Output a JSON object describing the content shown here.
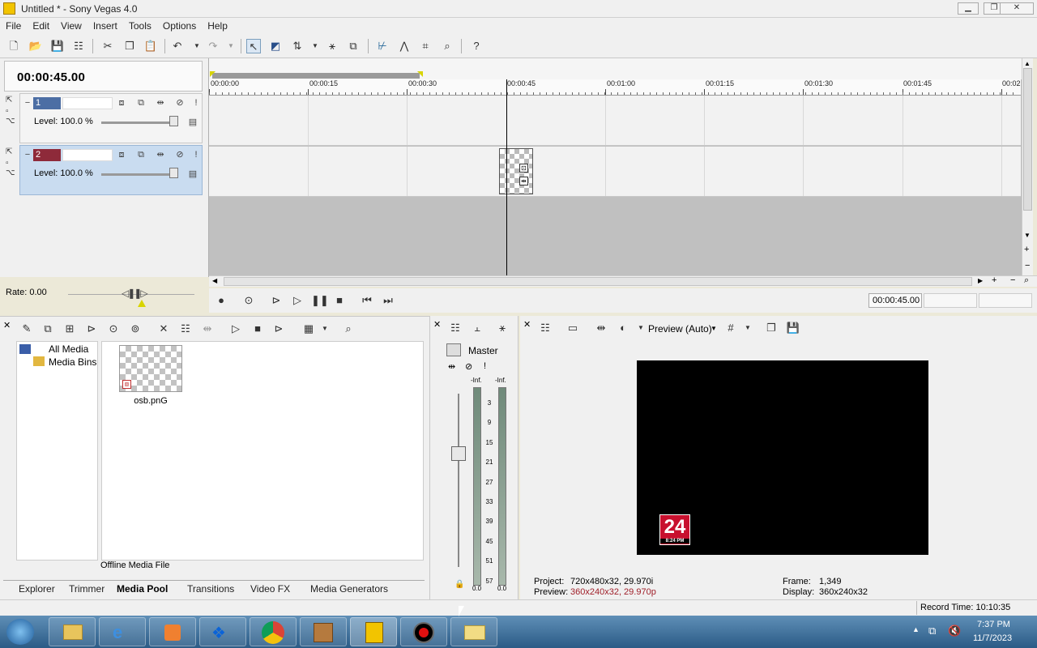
{
  "window": {
    "title": "Untitled * - Sony Vegas 4.0",
    "buttons": [
      "▁",
      "❐",
      "✕"
    ]
  },
  "menu": [
    "File",
    "Edit",
    "View",
    "Insert",
    "Tools",
    "Options",
    "Help"
  ],
  "toolbar": {
    "icons": [
      "new-icon",
      "open-icon",
      "save-icon",
      "properties-icon",
      "cut-icon",
      "copy-icon",
      "paste-icon",
      "undo-icon",
      "redo-icon",
      "normal-edit-tool-icon",
      "envelope-tool-icon",
      "selection-tool-icon",
      "ripple-icon",
      "auto-crossfade-icon",
      "snapping-icon",
      "markers-icon",
      "region-icon",
      "zoom-tool-icon",
      "whats-this-icon"
    ]
  },
  "timeline": {
    "cursor_time": "00:00:45.00",
    "ruler_ticks": [
      "00:00:00",
      "00:00:15",
      "00:00:30",
      "00:00:45",
      "00:01:00",
      "00:01:15",
      "00:01:30",
      "00:01:45",
      "00:02"
    ],
    "tracks": [
      {
        "number": "1",
        "level": "Level: 100.0 %"
      },
      {
        "number": "2",
        "level": "Level: 100.0 %"
      }
    ],
    "rate": "Rate: 0.00"
  },
  "transport": {
    "time": "00:00:45.00"
  },
  "media_pool": {
    "tree": [
      "All Media",
      "Media Bins"
    ],
    "file_name": "osb.pnG",
    "status": "Offline Media File",
    "tabs": [
      "Explorer",
      "Trimmer",
      "Media Pool",
      "Transitions",
      "Video FX",
      "Media Generators"
    ],
    "active_tab": "Media Pool"
  },
  "mixer": {
    "label": "Master",
    "peak_left": "-Inf.",
    "peak_right": "-Inf.",
    "scale": [
      "3",
      "9",
      "15",
      "21",
      "27",
      "33",
      "39",
      "45",
      "51",
      "57"
    ],
    "readout_left": "0.0",
    "readout_right": "0.0"
  },
  "preview": {
    "quality": "Preview (Auto)",
    "logo_number": "24",
    "logo_time": "8:24 PM",
    "project_label": "Project:",
    "project_value": "720x480x32, 29.970i",
    "preview_label": "Preview:",
    "preview_value": "360x240x32, 29.970p",
    "frame_label": "Frame:",
    "frame_value": "1,349",
    "display_label": "Display:",
    "display_value": "360x240x32",
    "accent_red": "#a0202a"
  },
  "status": {
    "record_time": "Record Time: 10:10:35"
  },
  "taskbar": {
    "time": "7:37 PM",
    "date": "11/7/2023"
  }
}
